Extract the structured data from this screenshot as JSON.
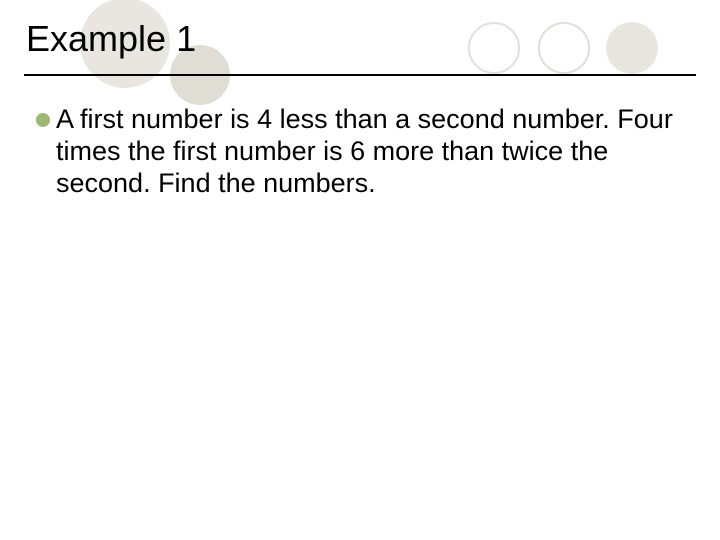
{
  "title": "Example 1",
  "bullet": {
    "text": "A first number is 4 less than a second number.  Four times the first number is 6 more than twice the second. Find the numbers."
  },
  "colors": {
    "bullet_fill": "#9ab973",
    "circle_fill": "#e8e6de",
    "circle_stroke": "#e2e0d6"
  }
}
